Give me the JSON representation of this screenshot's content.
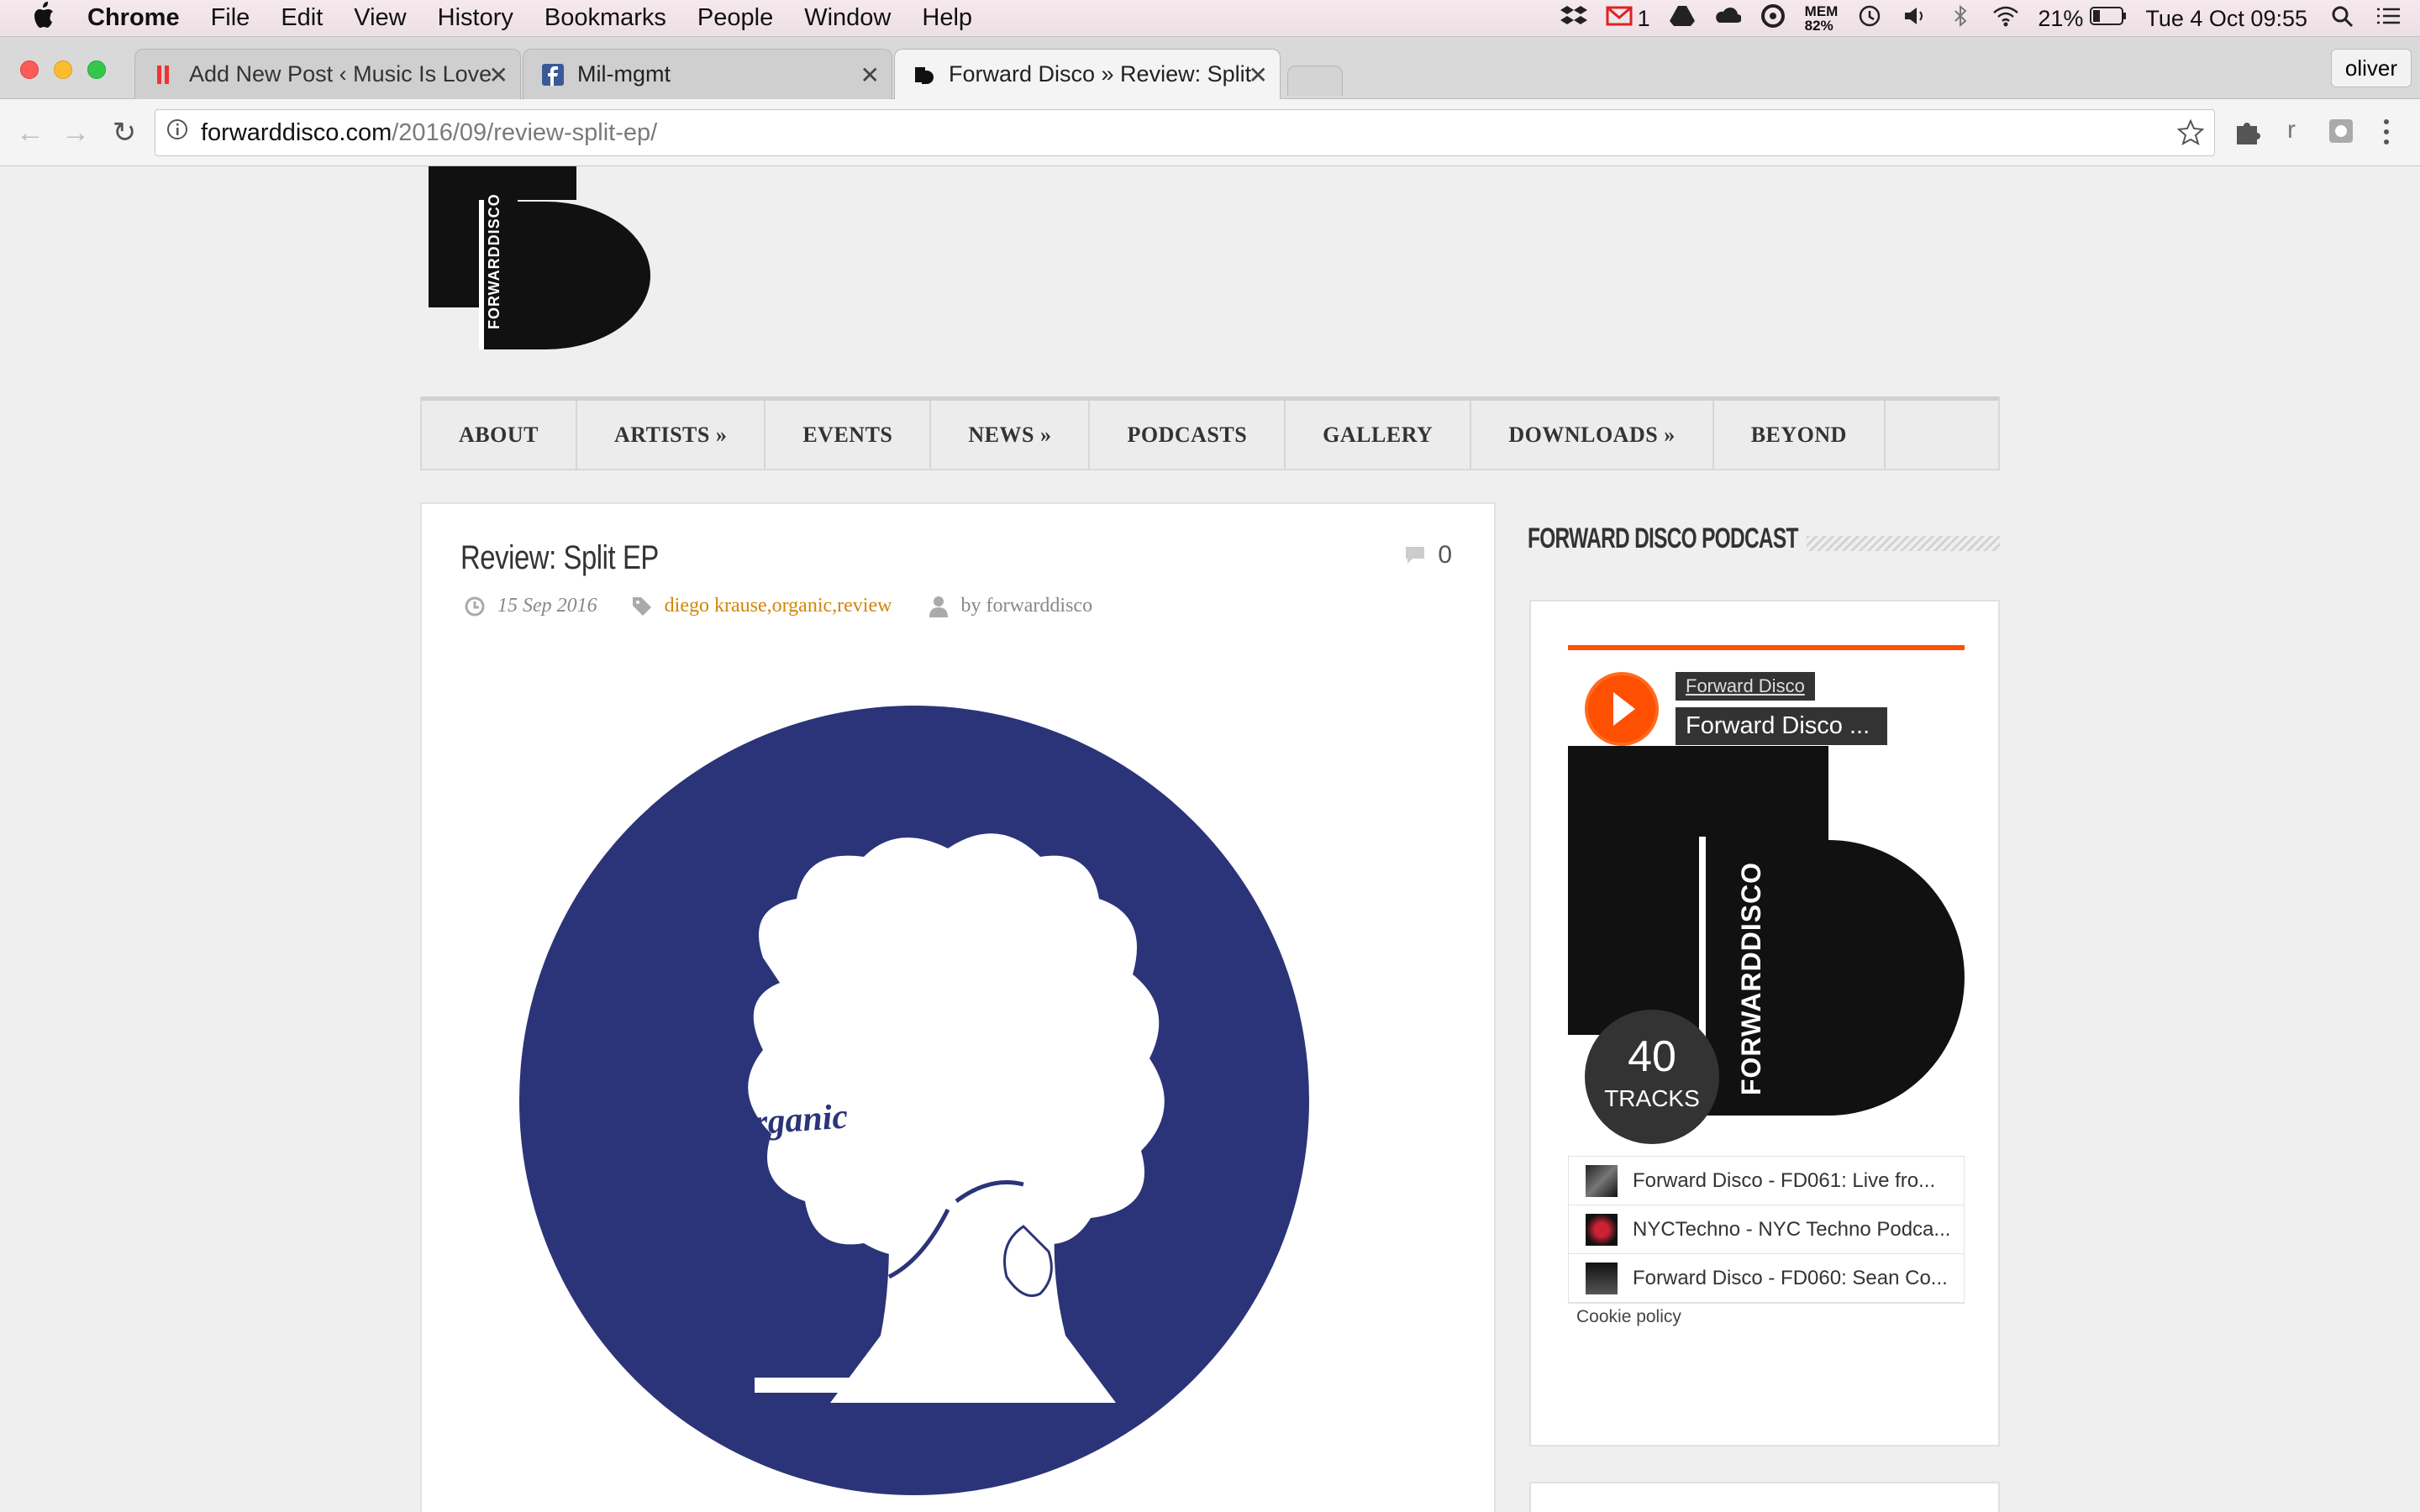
{
  "menubar": {
    "app_name": "Chrome",
    "items": [
      "File",
      "Edit",
      "View",
      "History",
      "Bookmarks",
      "People",
      "Window",
      "Help"
    ],
    "mail_count": "1",
    "mem_label": "MEM",
    "mem_value": "82%",
    "battery": "21%",
    "datetime": "Tue 4 Oct  09:55"
  },
  "tabs": [
    {
      "title": "Add New Post ‹ Music Is Love",
      "favicon": "wordpress-red-icon"
    },
    {
      "title": "Mil-mgmt",
      "favicon": "facebook-icon"
    },
    {
      "title": "Forward Disco » Review: Split",
      "favicon": "forward-disco-icon"
    }
  ],
  "profile_name": "oliver",
  "address": {
    "host": "forwarddisco.com",
    "path": "/2016/09/review-split-ep/"
  },
  "nav": [
    "ABOUT",
    "ARTISTS »",
    "EVENTS",
    "NEWS »",
    "PODCASTS",
    "GALLERY",
    "DOWNLOADS »",
    "BEYOND"
  ],
  "logo": {
    "vertical_text": "FORWARDDISCO"
  },
  "article": {
    "title": "Review: Split EP",
    "date": "15 Sep 2016",
    "tags": "diego krause,organic,review",
    "author": "by forwarddisco",
    "comment_count": "0",
    "cover_text": "organic"
  },
  "sidebar": {
    "title": "FORWARD DISCO PODCAST",
    "player": {
      "user": "Forward Disco",
      "track": "Forward Disco ...",
      "art_text": "FORWARDDISCO",
      "track_count": "40",
      "track_label": "TRACKS",
      "tracks": [
        "Forward Disco - FD061: Live fro...",
        "NYCTechno - NYC Techno Podca...",
        "Forward Disco - FD060: Sean Co..."
      ],
      "cookie": "Cookie policy"
    }
  },
  "colors": {
    "accent": "#ff4f00",
    "tag": "#d28609",
    "cover_blue": "#2b3478"
  }
}
